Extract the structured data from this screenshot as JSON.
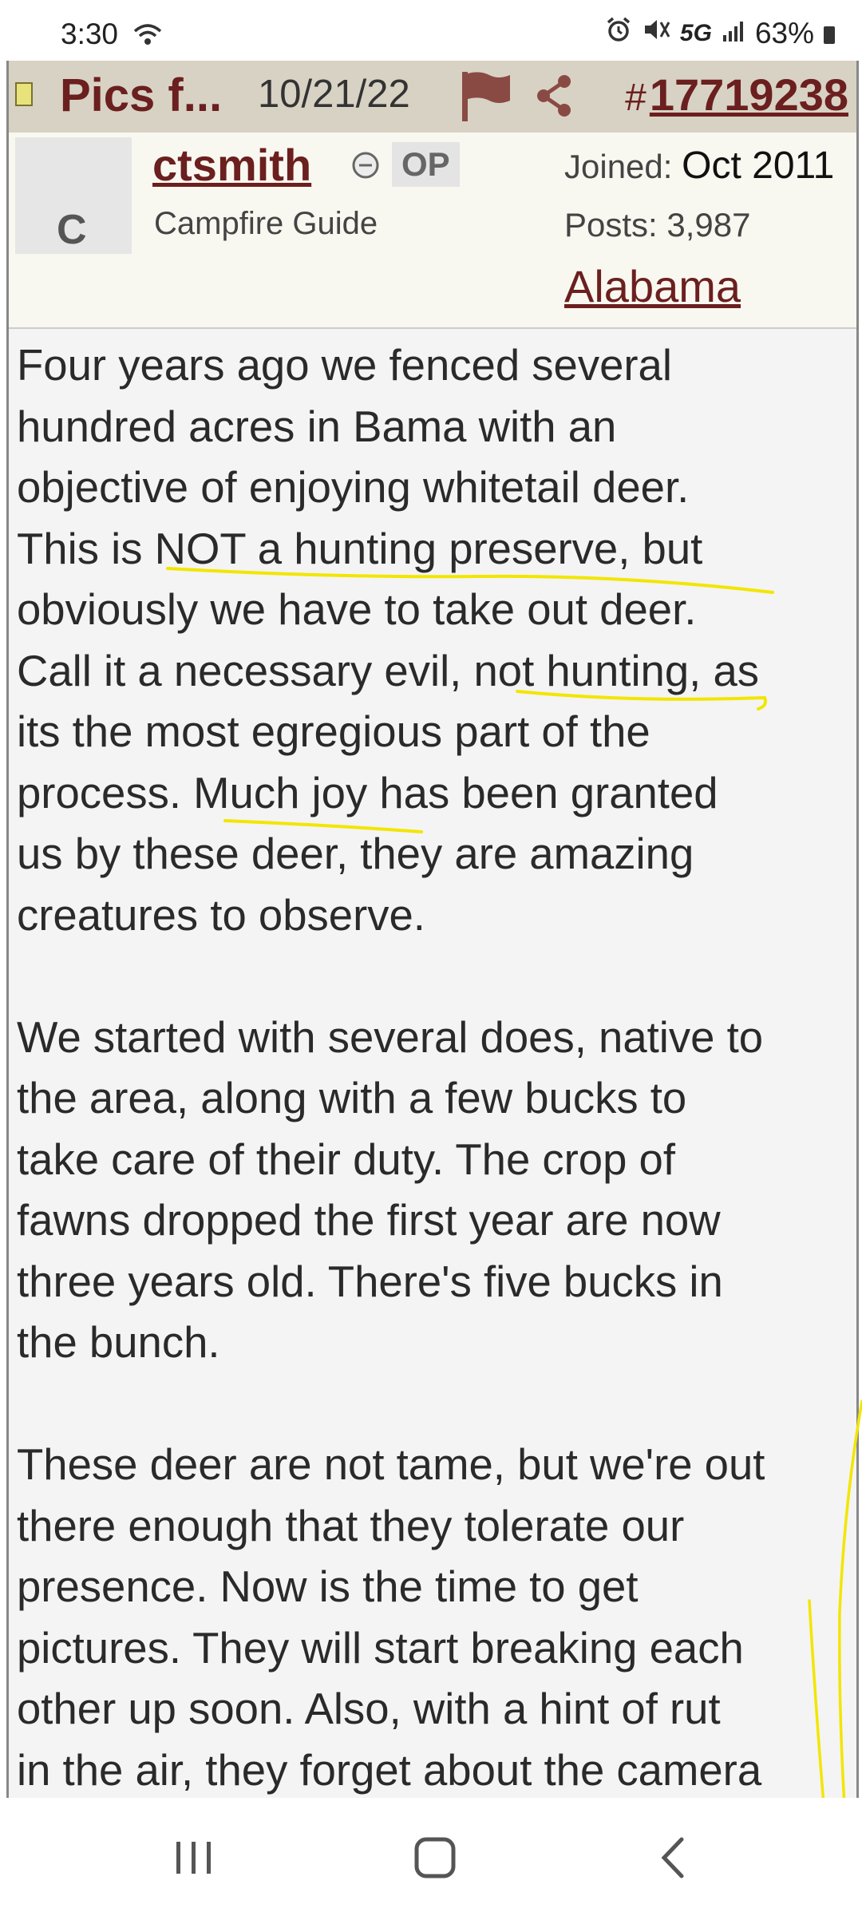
{
  "status_bar": {
    "time": "3:30",
    "network": "5G",
    "battery": "63%",
    "icons": [
      "wifi-icon",
      "alarm-icon",
      "mute-icon",
      "signal-icon",
      "battery-icon"
    ]
  },
  "thread_bar": {
    "title": "Pics f...",
    "date": "10/21/22",
    "post_hash": "#",
    "post_number": "17719238",
    "icons": [
      "document-icon",
      "flag-icon",
      "share-icon"
    ]
  },
  "user": {
    "avatar_letter": "C",
    "username": "ctsmith",
    "badge": "OP",
    "title": "Campfire Guide",
    "joined_label": "Joined:",
    "joined_value": "Oct 2011",
    "posts_label": "Posts:",
    "posts_value": "3,987",
    "location": "Alabama"
  },
  "post": {
    "lines": [
      "Four years ago we fenced several",
      "hundred acres in Bama with an",
      "objective of enjoying whitetail deer.",
      "This is NOT a hunting preserve, but",
      "obviously we have to take out deer.",
      "Call it a necessary evil, not hunting, as",
      "its the most egregious part of the",
      "process. Much joy has been granted",
      "us by these deer, they are amazing",
      "creatures to observe.",
      "",
      "We started with several does, native to",
      "the area, along with a few bucks to",
      "take care of their duty. The crop of",
      "fawns dropped the first year are now",
      "three years old. There's five bucks in",
      "the bunch.",
      "",
      "These deer are not tame, but we're out",
      "there enough that they tolerate our",
      "presence. Now is the time to get",
      "pictures. They will start breaking each",
      "other up soon. Also, with a hint of rut",
      "in the air, they forget about the camera"
    ]
  },
  "colors": {
    "link": "#6b1f1f",
    "header_bg": "#d8d2c4",
    "highlight": "#f2e600"
  }
}
